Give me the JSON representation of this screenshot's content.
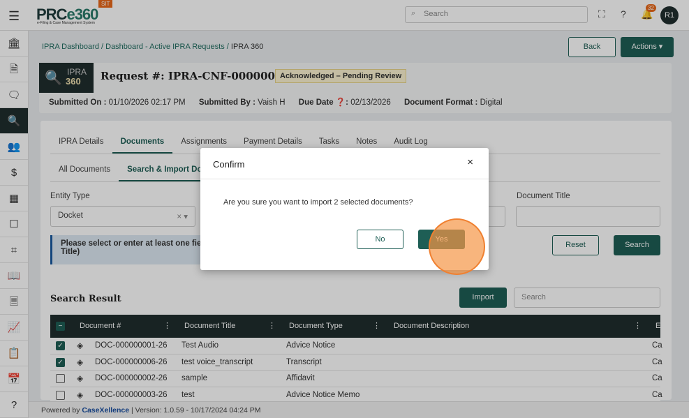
{
  "app": {
    "logo": "PRCe360",
    "logo_sub": "e-Filing & Case Management System",
    "env_badge": "SIT",
    "search_placeholder": "Search",
    "notification_count": "32",
    "avatar": "R1"
  },
  "sidebar": {
    "items": [
      "bank-icon",
      "document-icon",
      "chat-icon",
      "doc-search-icon",
      "users-icon",
      "file-dollar-icon",
      "building-icon",
      "form-icon",
      "scan-icon",
      "book-icon",
      "file-text-icon",
      "chart-icon",
      "clipboard-icon",
      "calendar-icon",
      "help-icon"
    ],
    "active_index": 3
  },
  "breadcrumb": {
    "items": [
      "IPRA Dashboard",
      "Dashboard - Active IPRA Requests"
    ],
    "current": "IPRA 360",
    "sep": "/"
  },
  "header": {
    "back": "Back",
    "actions": "Actions ▾",
    "block_line1": "IPRA",
    "block_line2": "360",
    "request_label": "Request #:",
    "request_id": "IPRA-CNF-0000004-26",
    "status": "Acknowledged – Pending Review",
    "meta": {
      "submitted_on_label": "Submitted On :",
      "submitted_on": "01/10/2026 02:17 PM",
      "submitted_by_label": "Submitted By :",
      "submitted_by": "Vaish H",
      "due_date_label": "Due Date ❓:",
      "due_date": "02/13/2026",
      "format_label": "Document Format :",
      "format": "Digital"
    }
  },
  "tabs": [
    "IPRA Details",
    "Documents",
    "Assignments",
    "Payment Details",
    "Tasks",
    "Notes",
    "Audit Log"
  ],
  "subtabs": [
    "All Documents",
    "Search & Import Doc"
  ],
  "form": {
    "entity_type_label": "Entity Type",
    "entity_type_value": "Docket",
    "document_title_label": "Document Title",
    "alert": "Please select or enter at least one field (... Title)",
    "alert_line1": "Please select or enter at least one fie",
    "alert_line2": "Title)",
    "reset": "Reset",
    "search": "Search"
  },
  "results": {
    "title": "Search Result",
    "import": "Import",
    "search_placeholder": "Search",
    "columns": [
      "Document #",
      "Document Title",
      "Document Type",
      "Document Description",
      "E"
    ],
    "rows": [
      {
        "checked": true,
        "doc": "DOC-000000001-26",
        "title": "Test Audio",
        "type": "Advice Notice",
        "desc": "",
        "e": "Ca"
      },
      {
        "checked": true,
        "doc": "DOC-000000006-26",
        "title": "test voice_transcript",
        "type": "Transcript",
        "desc": "",
        "e": "Ca"
      },
      {
        "checked": false,
        "doc": "DOC-000000002-26",
        "title": "sample",
        "type": "Affidavit",
        "desc": "",
        "e": "Ca"
      },
      {
        "checked": false,
        "doc": "DOC-000000003-26",
        "title": "test",
        "type": "Advice Notice Memo",
        "desc": "",
        "e": "Ca"
      }
    ]
  },
  "footer": {
    "powered": "Powered by",
    "brand": "CaseXellence",
    "sep": "|",
    "version": "Version: 1.0.59 - 10/17/2024 04:24 PM"
  },
  "modal": {
    "title": "Confirm",
    "close": "×",
    "message": "Are you sure you want to import 2 selected documents?",
    "no": "No",
    "yes": "Yes"
  }
}
